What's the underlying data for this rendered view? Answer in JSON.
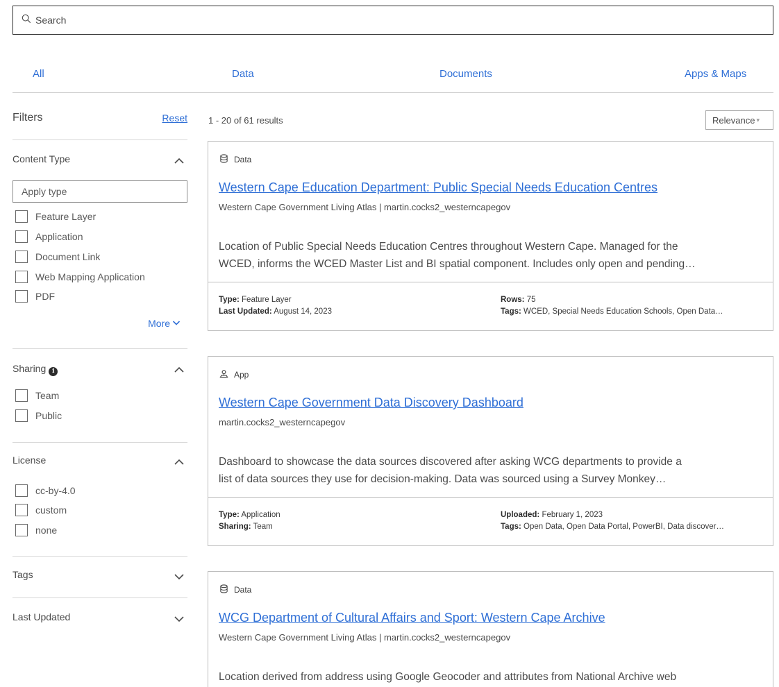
{
  "search": {
    "placeholder": "Search",
    "icon": "search-icon"
  },
  "tabs": [
    {
      "label": "All"
    },
    {
      "label": "Data"
    },
    {
      "label": "Documents"
    },
    {
      "label": "Apps & Maps"
    }
  ],
  "filters": {
    "title": "Filters",
    "reset_label": "Reset",
    "content_type": {
      "title": "Content Type",
      "input_placeholder": "Apply type",
      "options": [
        "Feature Layer",
        "Application",
        "Document Link",
        "Web Mapping Application",
        "PDF"
      ],
      "more_label": "More"
    },
    "sharing": {
      "title": "Sharing",
      "info_glyph": "i",
      "options": [
        "Team",
        "Public"
      ]
    },
    "license": {
      "title": "License",
      "options": [
        "cc-by-4.0",
        "custom",
        "none"
      ]
    },
    "tags": {
      "title": "Tags"
    },
    "last_updated": {
      "title": "Last Updated"
    }
  },
  "results": {
    "count_text": "1 - 20 of 61 results",
    "sort_label": "Relevance",
    "sort_caret": "▾"
  },
  "cards": [
    {
      "type_icon": "database-icon",
      "type_label": "Data",
      "title": "Western Cape Education Department: Public Special Needs Education Centres",
      "owner": "Western Cape Government Living Atlas | martin.cocks2_westerncapegov",
      "desc_line1": "Location of Public Special Needs Education Centres throughout Western Cape. Managed for the",
      "desc_line2": "WCED, informs the WCED Master List and BI spatial component. Includes only open and pending…",
      "meta_l1_key": "Type:",
      "meta_l1_val": "Feature Layer",
      "meta_l2_key": "Last Updated:",
      "meta_l2_val": "August 14, 2023",
      "meta_r1_key": "Rows:",
      "meta_r1_val": "75",
      "meta_r2_key": "Tags:",
      "meta_r2_val": "WCED, Special Needs Education Schools, Open Data…"
    },
    {
      "type_icon": "app-icon",
      "type_label": "App",
      "title": "Western Cape Government Data Discovery Dashboard",
      "owner": "martin.cocks2_westerncapegov",
      "desc_line1": "Dashboard to showcase the data sources discovered after asking WCG departments to provide a",
      "desc_line2": "list of data sources they use for decision-making. Data was sourced using a Survey Monkey…",
      "meta_l1_key": "Type:",
      "meta_l1_val": "Application",
      "meta_l2_key": "Sharing:",
      "meta_l2_val": "Team",
      "meta_r1_key": "Uploaded:",
      "meta_r1_val": "February 1, 2023",
      "meta_r2_key": "Tags:",
      "meta_r2_val": "Open Data, Open Data Portal, PowerBI, Data discover…"
    },
    {
      "type_icon": "database-icon",
      "type_label": "Data",
      "title": "WCG Department of Cultural Affairs and Sport: Western Cape Archive",
      "owner": "Western Cape Government Living Atlas | martin.cocks2_westerncapegov",
      "desc_line1": "Location derived from address using Google Geocoder and attributes from National Archive web"
    }
  ]
}
